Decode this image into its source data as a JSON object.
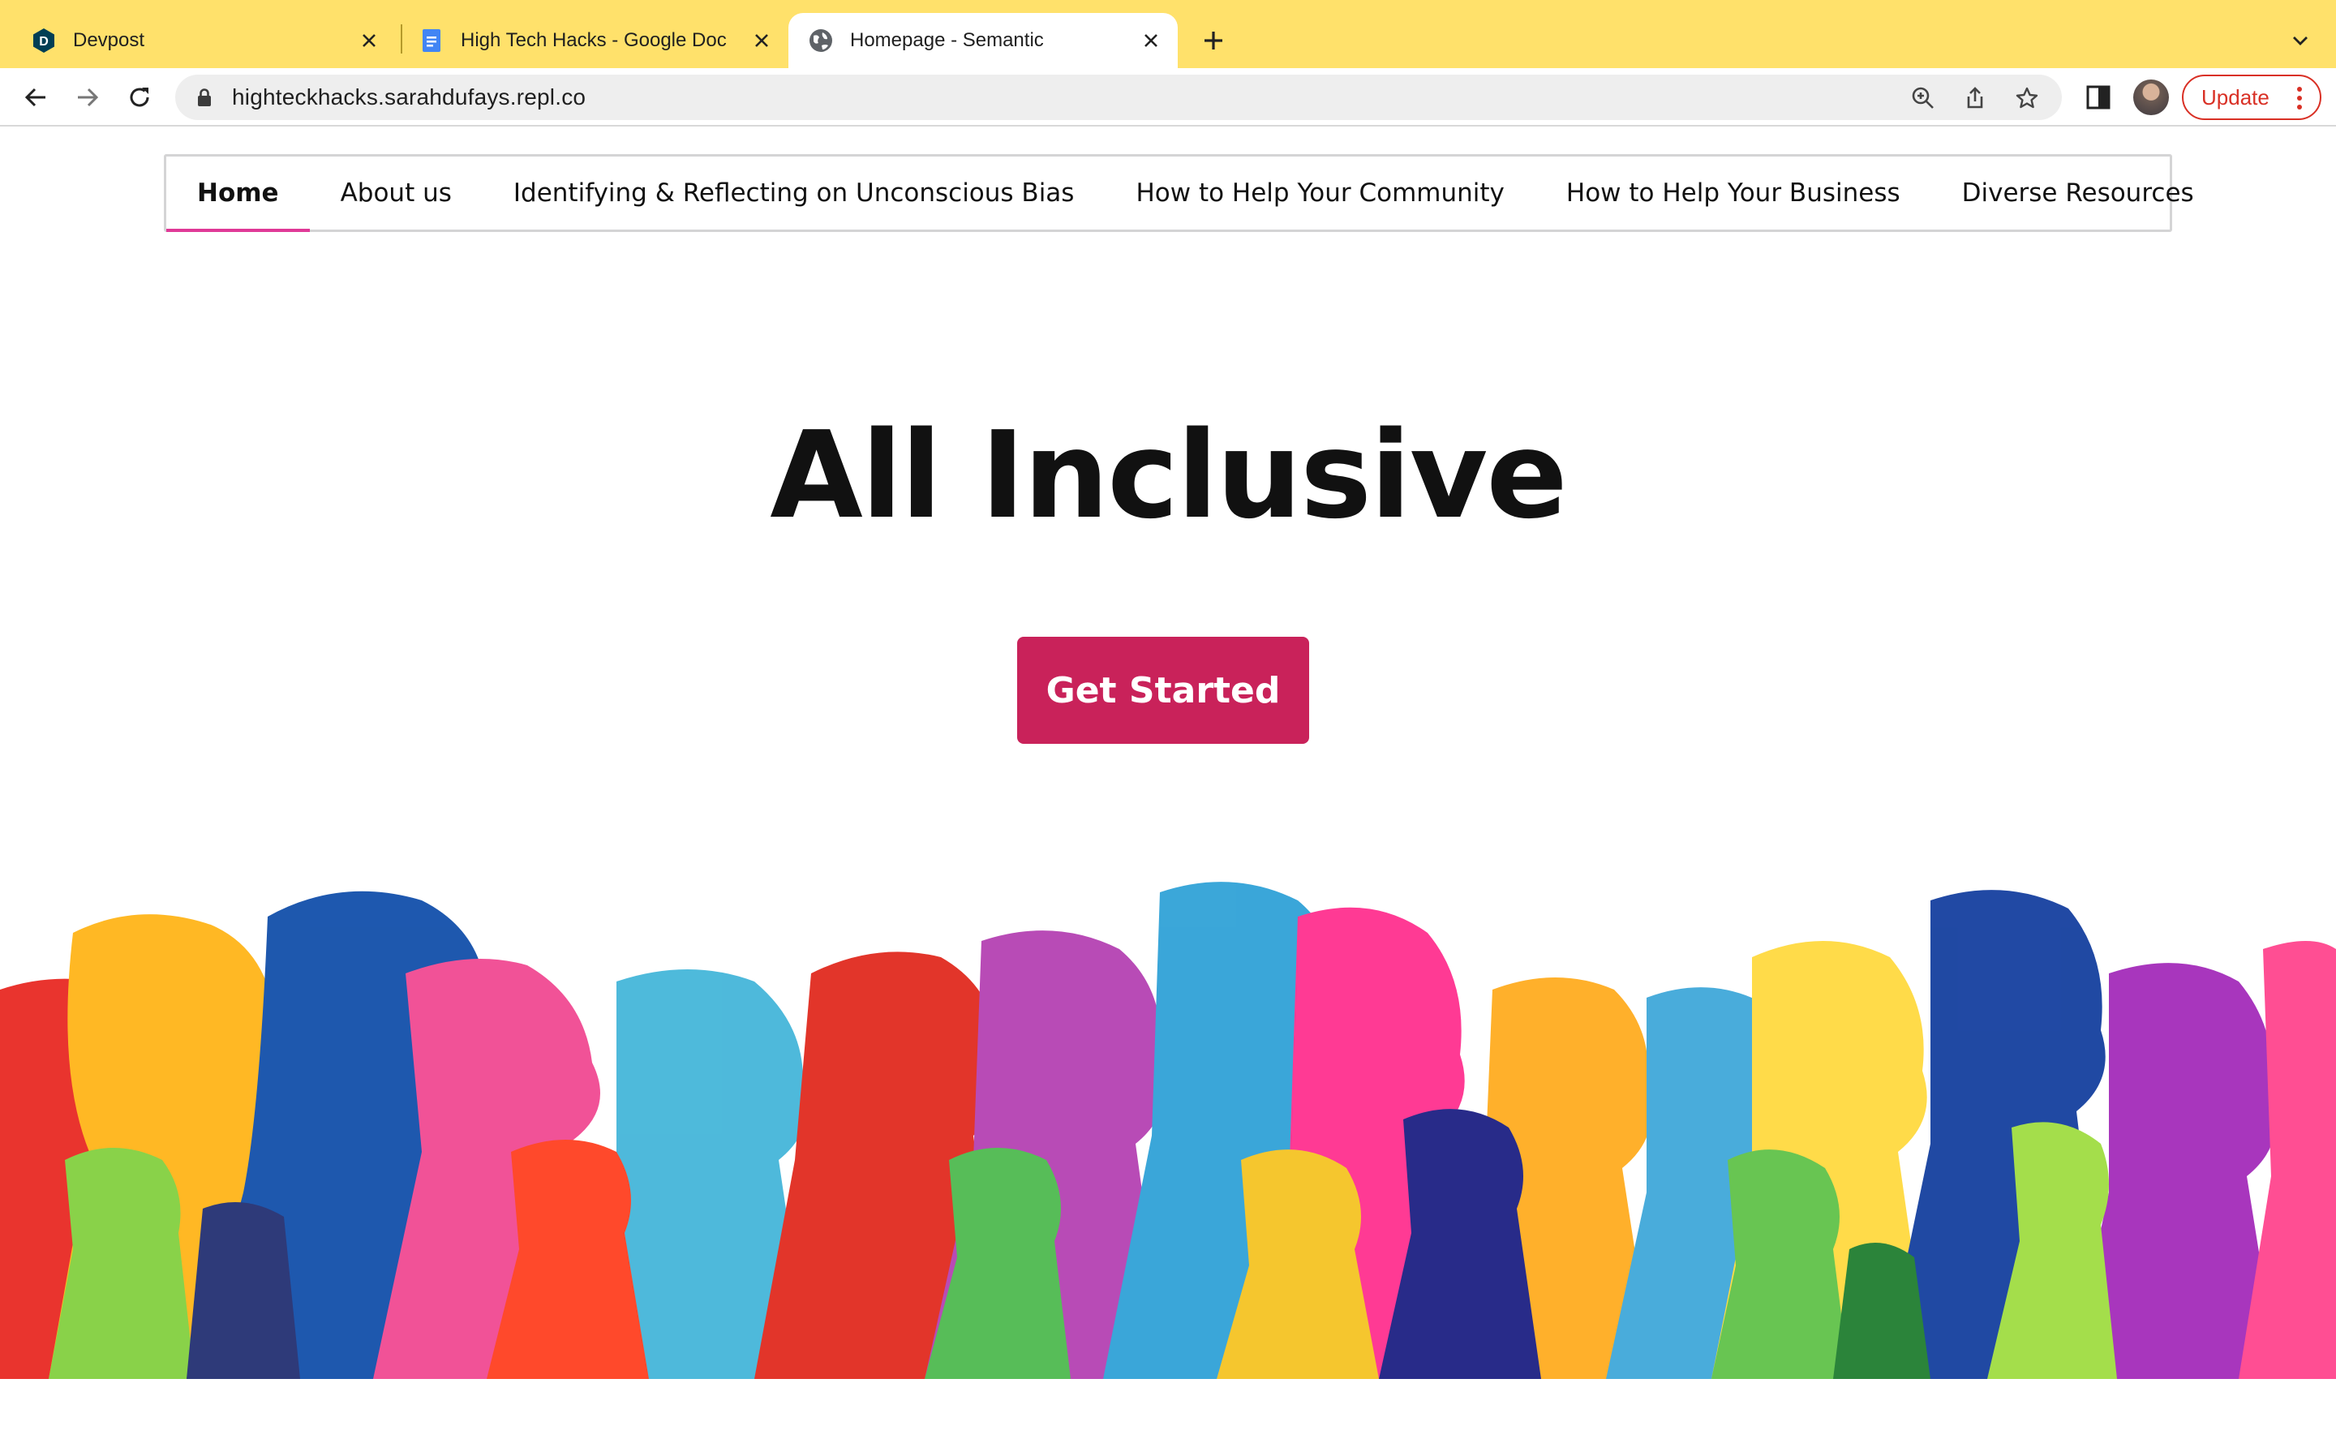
{
  "browser": {
    "tabs": [
      {
        "title": "Devpost",
        "favicon": "devpost-icon",
        "active": false
      },
      {
        "title": "High Tech Hacks - Google Doc",
        "favicon": "google-docs-icon",
        "active": false
      },
      {
        "title": "Homepage - Semantic",
        "favicon": "globe-icon",
        "active": true
      }
    ],
    "url": "highteckhacks.sarahdufays.repl.co",
    "update_label": "Update",
    "colors": {
      "tabbar": "#ffe16b",
      "update": "#d93025"
    }
  },
  "page": {
    "menu": [
      {
        "label": "Home",
        "active": true
      },
      {
        "label": "About us",
        "active": false
      },
      {
        "label": "Identifying & Reflecting on Unconscious Bias",
        "active": false
      },
      {
        "label": "How to Help Your Community",
        "active": false
      },
      {
        "label": "How to Help Your Business",
        "active": false
      },
      {
        "label": "Diverse Resources",
        "active": false
      }
    ],
    "hero_title": "All Inclusive",
    "cta_label": "Get Started",
    "colors": {
      "accent": "#e03997",
      "cta": "#c9225a"
    }
  }
}
